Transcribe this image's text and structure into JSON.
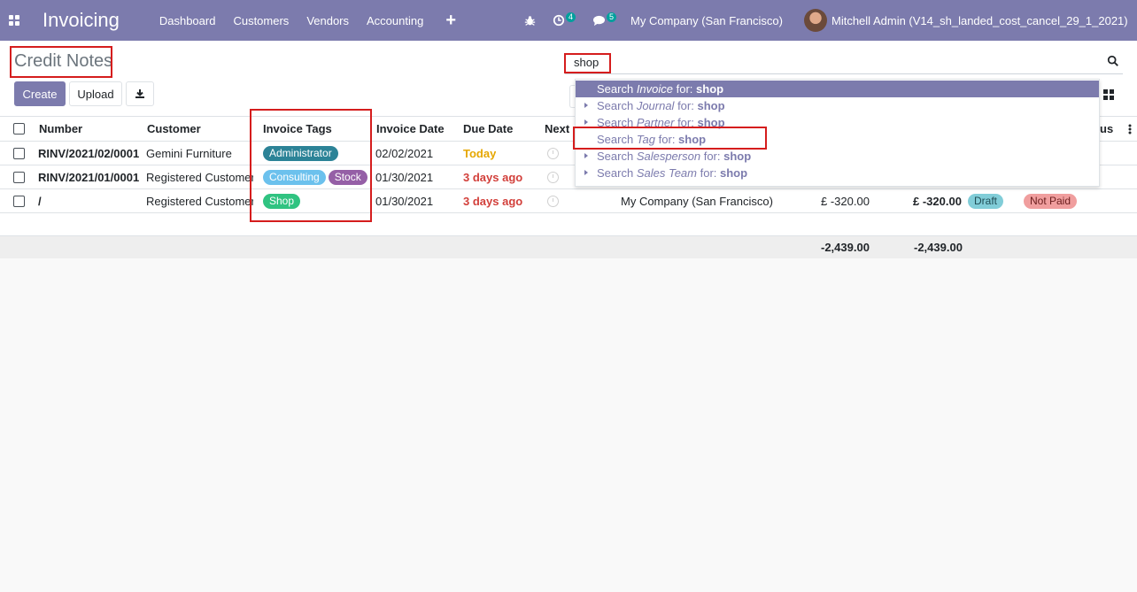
{
  "navbar": {
    "app_title": "Invoicing",
    "menu": [
      "Dashboard",
      "Customers",
      "Vendors",
      "Accounting"
    ],
    "plus_label": "+",
    "activity_count": "4",
    "message_count": "5",
    "company": "My Company (San Francisco)",
    "user": "Mitchell Admin (V14_sh_landed_cost_cancel_29_1_2021)"
  },
  "control": {
    "title": "Credit Notes",
    "create_label": "Create",
    "upload_label": "Upload",
    "search_value": "shop"
  },
  "dropdown": [
    {
      "prefix": "Search ",
      "field": "Invoice",
      "mid": " for: ",
      "term": "shop",
      "active": true,
      "caret": false
    },
    {
      "prefix": "Search ",
      "field": "Journal",
      "mid": " for: ",
      "term": "shop",
      "active": false,
      "caret": true
    },
    {
      "prefix": "Search ",
      "field": "Partner",
      "mid": " for: ",
      "term": "shop",
      "active": false,
      "caret": true
    },
    {
      "prefix": "Search ",
      "field": "Tag",
      "mid": " for: ",
      "term": "shop",
      "active": false,
      "caret": false
    },
    {
      "prefix": "Search ",
      "field": "Salesperson",
      "mid": " for: ",
      "term": "shop",
      "active": false,
      "caret": true
    },
    {
      "prefix": "Search ",
      "field": "Sales Team",
      "mid": " for: ",
      "term": "shop",
      "active": false,
      "caret": true
    }
  ],
  "table": {
    "headers": {
      "number": "Number",
      "customer": "Customer",
      "tags": "Invoice Tags",
      "invoice_date": "Invoice Date",
      "due_date": "Due Date",
      "next": "Next",
      "status": "us"
    },
    "rows": [
      {
        "number": "RINV/2021/02/0001",
        "customer": "Gemini Furniture",
        "tags": [
          {
            "label": "Administrator",
            "color": "#2c8397"
          }
        ],
        "invoice_date": "02/02/2021",
        "due_date": "Today",
        "due_class": "due-today",
        "company": "",
        "untaxed": "",
        "total": "",
        "state": "",
        "payment": ""
      },
      {
        "number": "RINV/2021/01/0001",
        "customer": "Registered Customer",
        "tags": [
          {
            "label": "Consulting",
            "color": "#6cc1ed"
          },
          {
            "label": "Stock",
            "color": "#955fa6"
          }
        ],
        "invoice_date": "01/30/2021",
        "due_date": "3 days ago",
        "due_class": "due-late",
        "company": "",
        "untaxed": "",
        "total": "",
        "state": "",
        "payment": ""
      },
      {
        "number": "/",
        "customer": "Registered Customer",
        "tags": [
          {
            "label": "Shop",
            "color": "#30c381"
          }
        ],
        "invoice_date": "01/30/2021",
        "due_date": "3 days ago",
        "due_class": "due-late",
        "company": "My Company (San Francisco)",
        "untaxed": "£ -320.00",
        "total": "£ -320.00",
        "state": "Draft",
        "payment": "Not Paid"
      }
    ],
    "footer": {
      "untaxed_total": "-2,439.00",
      "total": "-2,439.00"
    }
  },
  "colors": {
    "brand": "#7c7bad",
    "draft_badge": "#81cdd8",
    "not_paid_badge": "#f09e9e",
    "highlight": "#d51d1d"
  }
}
